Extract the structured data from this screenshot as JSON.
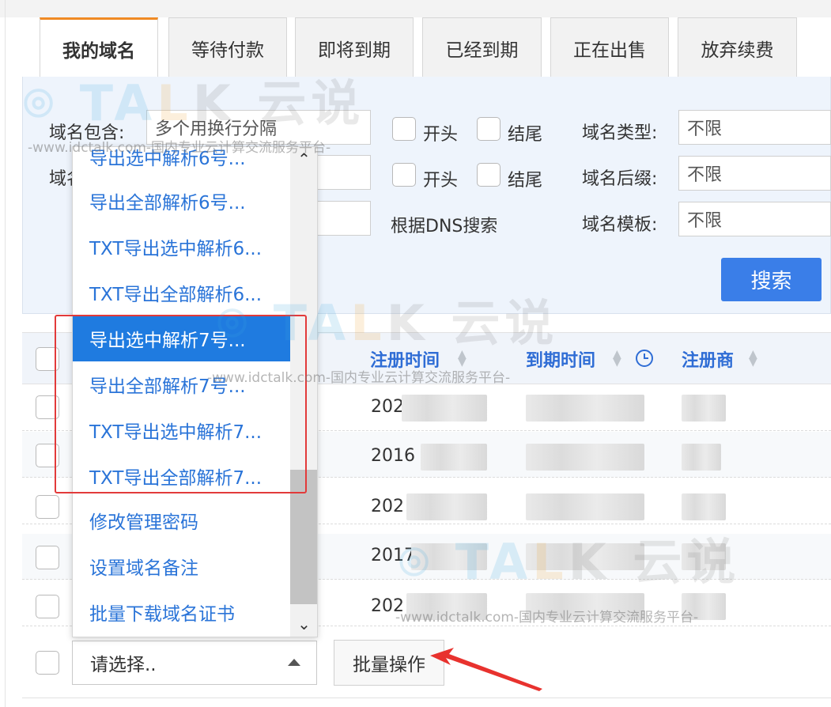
{
  "tabs": [
    "我的域名",
    "等待付款",
    "即将到期",
    "已经到期",
    "正在出售",
    "放弃续费"
  ],
  "search": {
    "domain_contains_label": "域名包含:",
    "domain_contains_value": "多个用换行分隔",
    "domain_second_label": "域名",
    "starts_label": "开头",
    "ends_label": "结尾",
    "dns_search_label": "根据DNS搜索",
    "type_label": "域名类型:",
    "type_value": "不限",
    "suffix_label": "域名后缀:",
    "suffix_value": "不限",
    "template_label": "域名模板:",
    "template_value": "不限",
    "search_button": "搜索"
  },
  "table": {
    "headers": [
      "注册时间",
      "到期时间",
      "注册商"
    ],
    "rows": [
      {
        "reg": "202"
      },
      {
        "reg": "2016"
      },
      {
        "reg": "202"
      },
      {
        "reg": "2017"
      },
      {
        "reg": "202"
      }
    ]
  },
  "dropdown": {
    "options": [
      "导出选中解析6号...",
      "导出全部解析6号...",
      "TXT导出选中解析6...",
      "TXT导出全部解析6...",
      "导出选中解析7号...",
      "导出全部解析7号...",
      "TXT导出选中解析7...",
      "TXT导出全部解析7...",
      "修改管理密码",
      "设置域名备注",
      "批量下载域名证书"
    ],
    "selected": "导出选中解析7号..."
  },
  "footer": {
    "select_value": "请选择..",
    "batch_button": "批量操作"
  },
  "watermark": {
    "brand_a": "TA",
    "brand_b": "L",
    "brand_c": "K 云说",
    "tagline": "-www.idctalk.com-国内专业云计算交流服务平台-"
  },
  "colors": {
    "accent_blue": "#3a7ee8",
    "link_blue": "#2a74d8",
    "tab_active_border": "#f08a24",
    "highlight_red": "#e23a3a",
    "arrow_red": "#e8322e"
  }
}
